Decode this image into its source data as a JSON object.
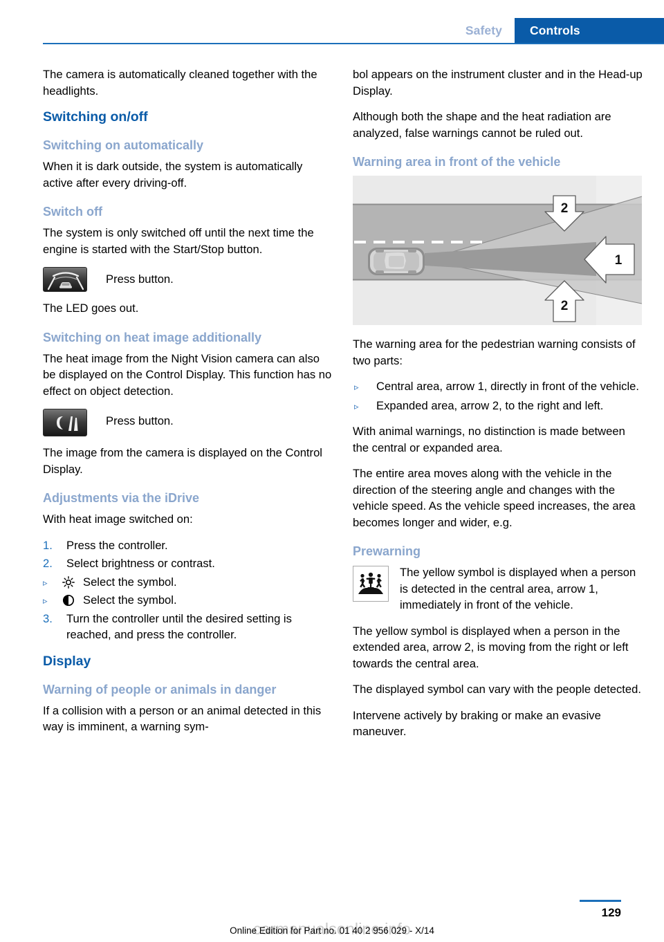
{
  "header": {
    "tab_inactive": "Safety",
    "tab_active": "Controls",
    "accent_color": "#0a5ba8",
    "muted_color": "#8aa6cd"
  },
  "left_column": {
    "intro_paragraph": "The camera is automatically cleaned together with the headlights.",
    "section_switching": {
      "title": "Switching on/off",
      "sub_auto": {
        "title": "Switching on automatically",
        "body": "When it is dark outside, the system is automatically active after every driving-off."
      },
      "sub_switch_off": {
        "title": "Switch off",
        "body": "The system is only switched off until the next time the engine is started with the Start/Stop button.",
        "button_label": "Press button.",
        "button_icon": "night-vision-button-icon",
        "after": "The LED goes out."
      },
      "sub_heat_image": {
        "title": "Switching on heat image additionally",
        "body": "The heat image from the Night Vision camera can also be displayed on the Control Display. This function has no effect on object detection.",
        "button_label": "Press button.",
        "button_icon": "heat-image-button-icon",
        "after": "The image from the camera is displayed on the Control Display."
      }
    },
    "section_idrive": {
      "title": "Adjustments via the iDrive",
      "intro": "With heat image switched on:",
      "steps": [
        {
          "num": "1.",
          "text": "Press the controller."
        },
        {
          "num": "2.",
          "text": "Select brightness or contrast."
        },
        {
          "num": "3.",
          "text": "Turn the controller until the desired setting is reached, and press the controller."
        }
      ],
      "sub_items": [
        {
          "bullet": "▹",
          "symbol": "brightness-sun-icon",
          "text": "Select the symbol."
        },
        {
          "bullet": "▹",
          "symbol": "contrast-half-circle-icon",
          "text": "Select the symbol."
        }
      ]
    },
    "section_display": {
      "title": "Display",
      "sub_warning": {
        "title": "Warning of people or animals in danger",
        "body": "If a collision with a person or an animal detected in this way is imminent, a warning sym-"
      }
    }
  },
  "right_column": {
    "continuation_paragraph": "bol appears on the instrument cluster and in the Head-up Display.",
    "paragraph_false_warnings": "Although both the shape and the heat radiation are analyzed, false warnings cannot be ruled out.",
    "section_warning_area": {
      "title": "Warning area in front of the vehicle",
      "figure": {
        "name": "warning-area-diagram",
        "description": "Top-down view of road with vehicle and warning cone areas",
        "arrow_labels": [
          "2",
          "1",
          "2"
        ]
      },
      "intro": "The warning area for the pedestrian warning consists of two parts:",
      "bullets": [
        {
          "bullet": "▹",
          "text": "Central area, arrow 1, directly in front of the vehicle."
        },
        {
          "bullet": "▹",
          "text": "Expanded area, arrow 2, to the right and left."
        }
      ],
      "para_animal": "With animal warnings, no distinction is made between the central or expanded area.",
      "para_moves": "The entire area moves along with the vehicle in the direction of the steering angle and changes with the vehicle speed. As the vehicle speed increases, the area becomes longer and wider, e.g."
    },
    "section_prewarning": {
      "title": "Prewarning",
      "icon": "pedestrian-warning-icon",
      "icon_para": "The yellow symbol is displayed when a person is detected in the central area, arrow 1, immediately in front of the vehicle.",
      "para_extended": "The yellow symbol is displayed when a person in the extended area, arrow 2, is moving from the right or left towards the central area.",
      "para_vary": "The displayed symbol can vary with the people detected.",
      "para_intervene": "Intervene actively by braking or make an evasive maneuver."
    }
  },
  "footer": {
    "edition_line": "Online Edition for Part no. 01 40 2 956 029 - X/14",
    "page_number": "129",
    "watermark": "carmanualsonline.info"
  }
}
